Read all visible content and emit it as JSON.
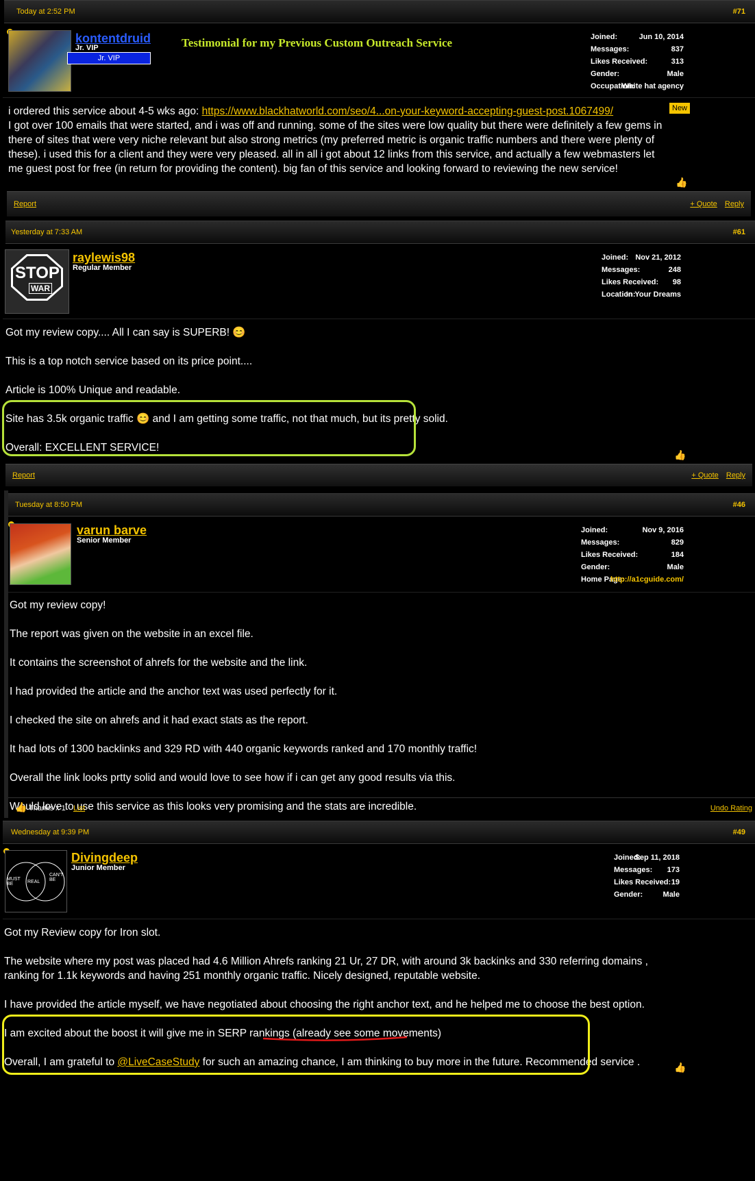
{
  "posts": [
    {
      "date": "Today at 2:52 PM",
      "num": "#71",
      "username": "kontentdruid",
      "user_title": "Jr. VIP",
      "badge": "Jr. VIP",
      "headline": "Testimonial for my Previous Custom Outreach Service",
      "stats": [
        {
          "k": "Joined:",
          "v": "Jun 10, 2014"
        },
        {
          "k": "Messages:",
          "v": "837"
        },
        {
          "k": "Likes Received:",
          "v": "313"
        },
        {
          "k": "Gender:",
          "v": "Male"
        },
        {
          "k": "Occupation:",
          "v": "White hat agency"
        }
      ],
      "new_badge": "New",
      "body_prefix": "i ordered this service about 4-5 wks ago: ",
      "body_link": "https://www.blackhatworld.com/seo/4...on-your-keyword-accepting-guest-post.1067499/",
      "body_rest": "I got over 100 emails that were started, and i was off and running. some of the sites were low quality but there were definitely a few gems in there of sites that were very niche relevant but also strong metrics (my preferred metric is organic traffic numbers and there were plenty of these). i used this for a client and they were very pleased. all in all i got about 12 links from this service, and actually a few webmasters let me guest post for free (in return for providing the content). big fan of this service and looking forward to reviewing the new service!",
      "report": "Report",
      "quote": "+ Quote",
      "reply": "Reply"
    },
    {
      "date": "Yesterday at 7:33 AM",
      "num": "#61",
      "username": "raylewis98",
      "user_title": "Regular Member",
      "avatar_text_1": "STOP",
      "avatar_text_2": "WAR",
      "stats": [
        {
          "k": "Joined:",
          "v": "Nov 21, 2012"
        },
        {
          "k": "Messages:",
          "v": "248"
        },
        {
          "k": "Likes Received:",
          "v": "98"
        },
        {
          "k": "Location:",
          "v": "In Your Dreams"
        }
      ],
      "lines": [
        "Got my review copy.... All I can say is SUPERB! 😊",
        "This is a top notch service based on its price point....",
        "Article is 100% Unique and readable.",
        "Site has 3.5k organic traffic 😊 and I am getting some traffic, not that much, but its pretty solid.",
        "Overall: EXCELLENT SERVICE!"
      ],
      "report": "Report",
      "quote": "+ Quote",
      "reply": "Reply"
    },
    {
      "date": "Tuesday at 8:50 PM",
      "num": "#46",
      "username": "varun barve",
      "user_title": "Senior Member",
      "stats": [
        {
          "k": "Joined:",
          "v": "Nov 9, 2016"
        },
        {
          "k": "Messages:",
          "v": "829"
        },
        {
          "k": "Likes Received:",
          "v": "184"
        },
        {
          "k": "Gender:",
          "v": "Male"
        },
        {
          "k": "Home Page:",
          "v": "http://a1cguide.com/"
        }
      ],
      "lines": [
        "Got my review copy!",
        "The report was given on the website in an excel file.",
        "It contains the screenshot of ahrefs for the website and the link.",
        "I had provided the article and the anchor text was used perfectly for it.",
        "I checked the site on ahrefs and it had exact stats as the report.",
        "It had lots of 1300 backlinks and 329 RD with 440 organic keywords ranked and 170 monthly traffic!",
        "Overall the link looks prtty solid and would love to see how if i can get any good results via this.",
        "Would love to use this service as this looks very promising and the stats are incredible."
      ],
      "thanks": "Thanks x 1",
      "list": "List",
      "undo": "Undo Rating"
    },
    {
      "date": "Wednesday at 9:39 PM",
      "num": "#49",
      "username": "Divingdeep",
      "user_title": "Junior Member",
      "avatar_left": "MUST BE",
      "avatar_mid": "REAL",
      "avatar_right": "CAN'T BE",
      "stats": [
        {
          "k": "Joined:",
          "v": "Sep 11, 2018"
        },
        {
          "k": "Messages:",
          "v": "173"
        },
        {
          "k": "Likes Received:",
          "v": "19"
        },
        {
          "k": "Gender:",
          "v": "Male"
        }
      ],
      "line1": "Got my Review copy for Iron slot.",
      "line2": "The website where my post was placed had 4.6 Million Ahrefs ranking 21 Ur, 27 DR, with around 3k backinks and 330 referring domains , ranking for 1.1k keywords and having 251 monthly organic traffic. Nicely designed, reputable website.",
      "line3": "I have provided the article myself, we have negotiated about choosing the right anchor text, and he helped me to choose the best option.",
      "line4": "I am excited about the boost it will give me in SERP rankings (already see some movements)",
      "line5_pre": "Overall, I am grateful to ",
      "line5_link": "@LiveCaseStudy",
      "line5_post": " for such an amazing chance, I am thinking to buy more in the future. Recommended service ."
    }
  ]
}
